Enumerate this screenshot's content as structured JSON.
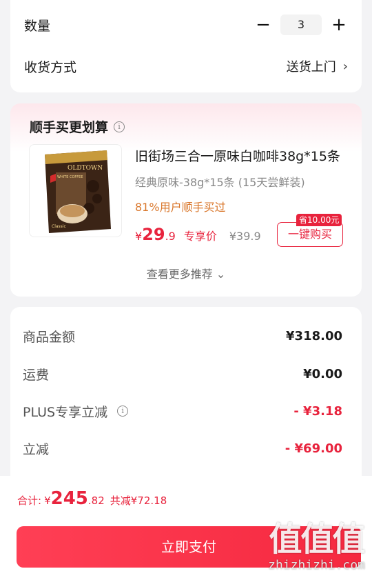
{
  "quantity": {
    "label": "数量",
    "minus": "−",
    "value": "3",
    "plus": "+"
  },
  "delivery": {
    "label": "收货方式",
    "value": "送货上门",
    "chevron": "›"
  },
  "recommend": {
    "title": "顺手买更划算",
    "info_icon": "info-icon",
    "product": {
      "name": "旧街场三合一原味白咖啡38g*15条",
      "spec": "经典原味-38g*15条 (15天尝鲜装)",
      "buy_rate": "81%用户顺手买过",
      "currency": "¥",
      "price_int": "29",
      "price_dec": ".9",
      "price_tag": "专享价",
      "original_price": "¥39.9",
      "save_badge": "省10.00元",
      "buy_button": "一键购买",
      "image_brand": "OLDTOWN",
      "image_brand_sub": "WHITE COFFEE",
      "image_flavor": "Classic"
    },
    "more": "查看更多推荐 ⌄"
  },
  "summary": {
    "rows": [
      {
        "label": "商品金额",
        "value": "¥318.00",
        "highlight": false
      },
      {
        "label": "运费",
        "value": "¥0.00",
        "highlight": false
      },
      {
        "label": "PLUS专享立减",
        "value": "- ¥3.18",
        "highlight": true,
        "info_icon": "info-icon"
      },
      {
        "label": "立减",
        "value": "- ¥69.00",
        "highlight": true
      }
    ]
  },
  "footer": {
    "total_label": "合计:",
    "currency": "¥",
    "total_int": "245",
    "total_dec": ".82",
    "saved": "共减¥72.18",
    "pay_button": "立即支付",
    "watermark_big": "值值值",
    "watermark_small": "zhizhizhi.com"
  },
  "colors": {
    "accent": "#e8233d",
    "orange": "#d9762a",
    "background": "#f3f3f5"
  }
}
